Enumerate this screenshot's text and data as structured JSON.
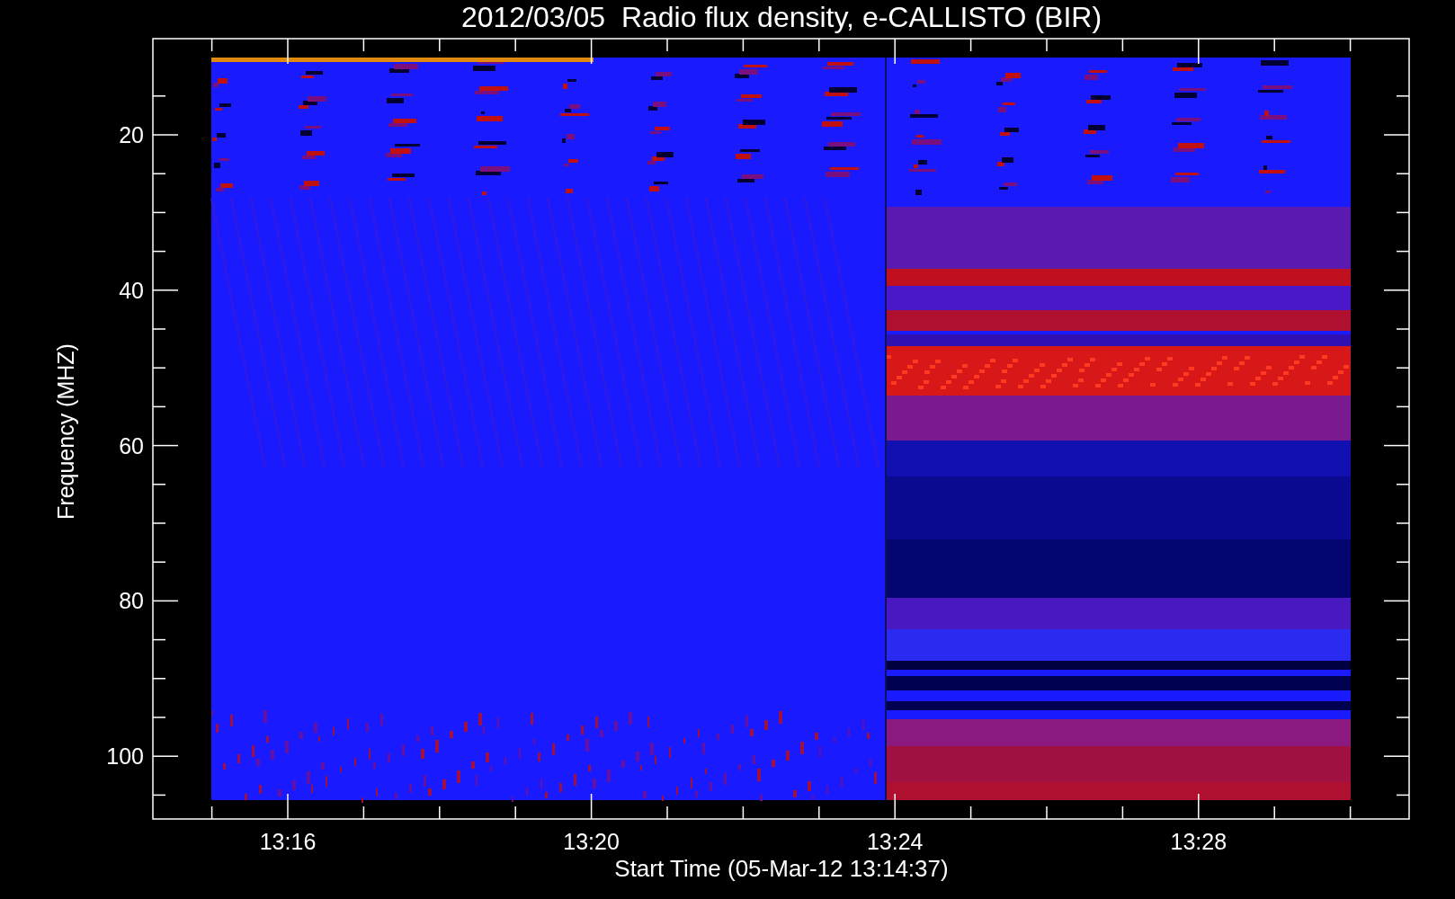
{
  "title": "2012/03/05  Radio flux density, e-CALLISTO (BIR)",
  "y_axis": {
    "label": "Frequency (MHZ)",
    "ticks": [
      "20",
      "40",
      "60",
      "80",
      "100"
    ]
  },
  "x_axis": {
    "label": "Start Time (05-Mar-12 13:14:37)",
    "ticks": [
      "13:16",
      "13:20",
      "13:24",
      "13:28"
    ]
  }
}
